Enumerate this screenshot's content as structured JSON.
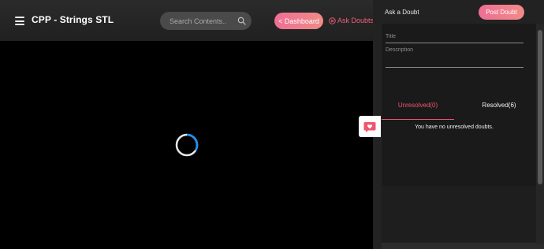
{
  "header": {
    "menu_icon": "hamburger-menu-icon",
    "title": "CPP - Strings STL",
    "search": {
      "placeholder": "Search Contents..",
      "icon": "search-icon"
    },
    "dashboard_label": "< Dashboard",
    "ask_doubts_label": "Ask Doubts",
    "ask_doubts_icon": "close-circle-icon"
  },
  "main": {
    "loading_icon": "loading-spinner-icon"
  },
  "doubt_panel": {
    "title": "Ask a Doubt",
    "post_button": "Post Doubt",
    "title_field_placeholder": "Title",
    "description_placeholder": "Description",
    "tabs": [
      {
        "label": "Unresolved(0)",
        "active": true
      },
      {
        "label": "Resolved(6)",
        "active": false
      }
    ],
    "empty_message": "You have no unresolved doubts.",
    "chat_toggle_icon": "heart-chat-icon"
  },
  "colors": {
    "accent": "#f0566f",
    "button_gradient_start": "#ee6f95",
    "button_gradient_end": "#f08b86",
    "spinner_arc": "#1e90ff"
  }
}
